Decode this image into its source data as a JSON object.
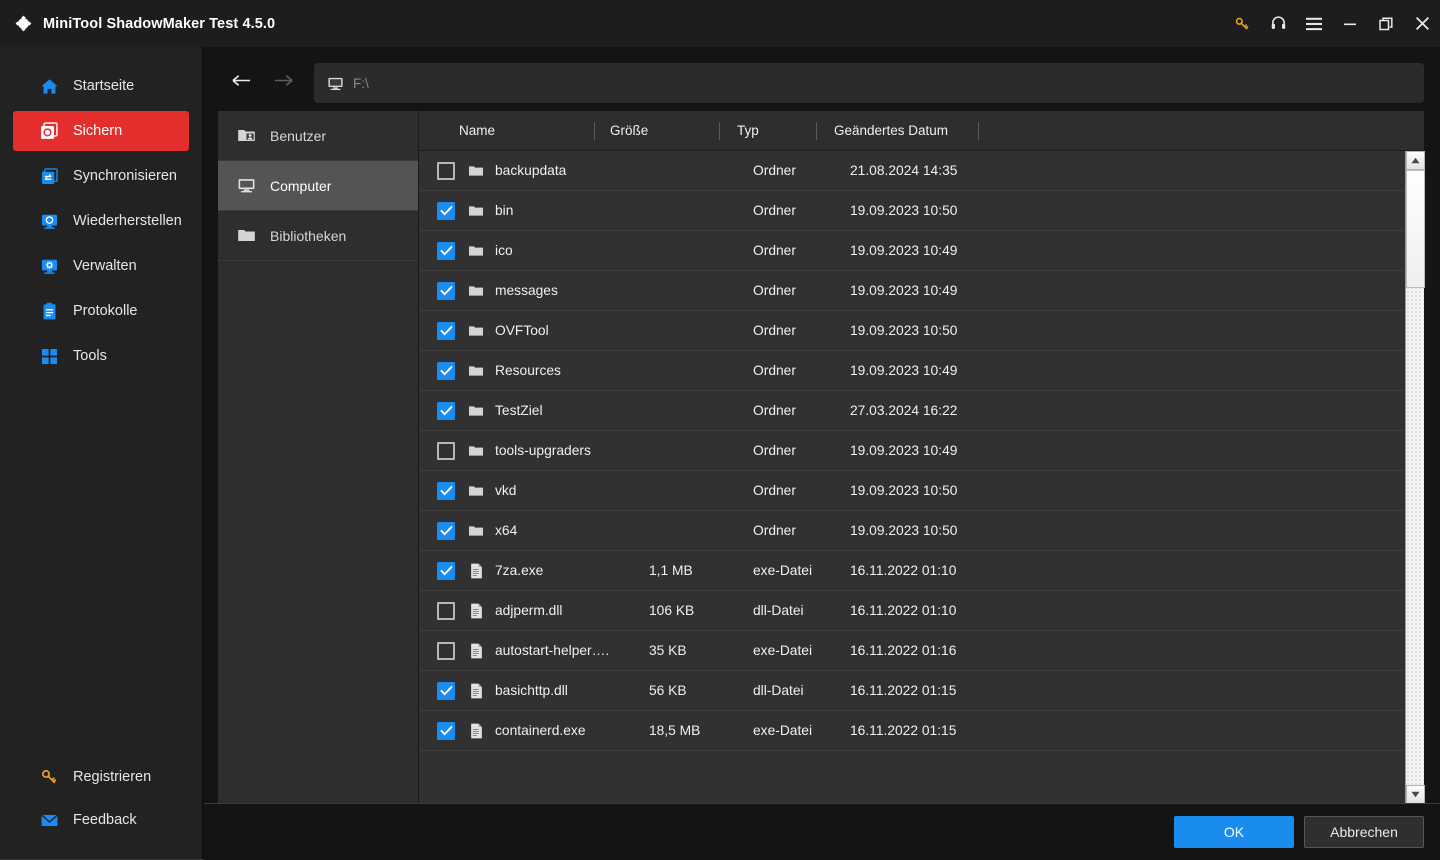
{
  "window": {
    "title": "MiniTool ShadowMaker Test 4.5.0",
    "logo_icon": "shadowmaker-logo-icon",
    "controls": [
      {
        "name": "key-icon",
        "glyph": "key"
      },
      {
        "name": "headset-icon",
        "glyph": "headset"
      },
      {
        "name": "menu-icon",
        "glyph": "hamburger"
      },
      {
        "name": "minimize-icon",
        "glyph": "minimize"
      },
      {
        "name": "restore-icon",
        "glyph": "restore"
      },
      {
        "name": "close-icon",
        "glyph": "close"
      }
    ]
  },
  "sidebar": {
    "items": [
      {
        "label": "Startseite",
        "icon": "home-icon",
        "active": false
      },
      {
        "label": "Sichern",
        "icon": "backup-icon",
        "active": true
      },
      {
        "label": "Synchronisieren",
        "icon": "sync-icon",
        "active": false
      },
      {
        "label": "Wiederherstellen",
        "icon": "restore-monitor-icon",
        "active": false
      },
      {
        "label": "Verwalten",
        "icon": "manage-gear-monitor-icon",
        "active": false
      },
      {
        "label": "Protokolle",
        "icon": "logs-clipboard-icon",
        "active": false
      },
      {
        "label": "Tools",
        "icon": "tools-grid-icon",
        "active": false
      }
    ],
    "bottom_items": [
      {
        "label": "Registrieren",
        "icon": "key-icon"
      },
      {
        "label": "Feedback",
        "icon": "mail-icon"
      }
    ],
    "accent_color": "#e42d2d",
    "icon_color": "#1a8cf0"
  },
  "navbar": {
    "back_icon": "arrow-left-icon",
    "forward_icon": "arrow-right-icon",
    "back_enabled": true,
    "forward_enabled": false,
    "path_icon": "computer-monitor-icon",
    "path": "F:\\"
  },
  "tree": {
    "items": [
      {
        "label": "Benutzer",
        "icon": "users-folder-icon",
        "selected": false
      },
      {
        "label": "Computer",
        "icon": "computer-monitor-icon",
        "selected": true
      },
      {
        "label": "Bibliotheken",
        "icon": "folder-icon",
        "selected": false
      }
    ]
  },
  "filelist": {
    "columns": [
      "Name",
      "Größe",
      "Typ",
      "Geändertes Datum"
    ],
    "rows": [
      {
        "checked": false,
        "icon": "folder-icon",
        "name": "backupdata",
        "size": "",
        "type": "Ordner",
        "date": "21.08.2024 14:35"
      },
      {
        "checked": true,
        "icon": "folder-icon",
        "name": "bin",
        "size": "",
        "type": "Ordner",
        "date": "19.09.2023 10:50"
      },
      {
        "checked": true,
        "icon": "folder-icon",
        "name": "ico",
        "size": "",
        "type": "Ordner",
        "date": "19.09.2023 10:49"
      },
      {
        "checked": true,
        "icon": "folder-icon",
        "name": "messages",
        "size": "",
        "type": "Ordner",
        "date": "19.09.2023 10:49"
      },
      {
        "checked": true,
        "icon": "folder-icon",
        "name": "OVFTool",
        "size": "",
        "type": "Ordner",
        "date": "19.09.2023 10:50"
      },
      {
        "checked": true,
        "icon": "folder-icon",
        "name": "Resources",
        "size": "",
        "type": "Ordner",
        "date": "19.09.2023 10:49"
      },
      {
        "checked": true,
        "icon": "folder-icon",
        "name": "TestZiel",
        "size": "",
        "type": "Ordner",
        "date": "27.03.2024 16:22"
      },
      {
        "checked": false,
        "icon": "folder-icon",
        "name": "tools-upgraders",
        "size": "",
        "type": "Ordner",
        "date": "19.09.2023 10:49"
      },
      {
        "checked": true,
        "icon": "folder-icon",
        "name": "vkd",
        "size": "",
        "type": "Ordner",
        "date": "19.09.2023 10:50"
      },
      {
        "checked": true,
        "icon": "folder-icon",
        "name": "x64",
        "size": "",
        "type": "Ordner",
        "date": "19.09.2023 10:50"
      },
      {
        "checked": true,
        "icon": "file-icon",
        "name": "7za.exe",
        "size": "1,1 MB",
        "type": "exe-Datei",
        "date": "16.11.2022 01:10"
      },
      {
        "checked": false,
        "icon": "file-icon",
        "name": "adjperm.dll",
        "size": "106 KB",
        "type": "dll-Datei",
        "date": "16.11.2022 01:10"
      },
      {
        "checked": false,
        "icon": "file-icon",
        "name": "autostart-helper….",
        "size": "35 KB",
        "type": "exe-Datei",
        "date": "16.11.2022 01:16"
      },
      {
        "checked": true,
        "icon": "file-icon",
        "name": "basichttp.dll",
        "size": "56 KB",
        "type": "dll-Datei",
        "date": "16.11.2022 01:15"
      },
      {
        "checked": true,
        "icon": "file-icon",
        "name": "containerd.exe",
        "size": "18,5 MB",
        "type": "exe-Datei",
        "date": "16.11.2022 01:15"
      }
    ],
    "scrollbar": {
      "up_icon": "scroll-up-arrow-icon",
      "down_icon": "scroll-down-arrow-icon"
    }
  },
  "footer": {
    "ok_label": "OK",
    "cancel_label": "Abbrechen",
    "ok_color": "#1a8cf0"
  }
}
